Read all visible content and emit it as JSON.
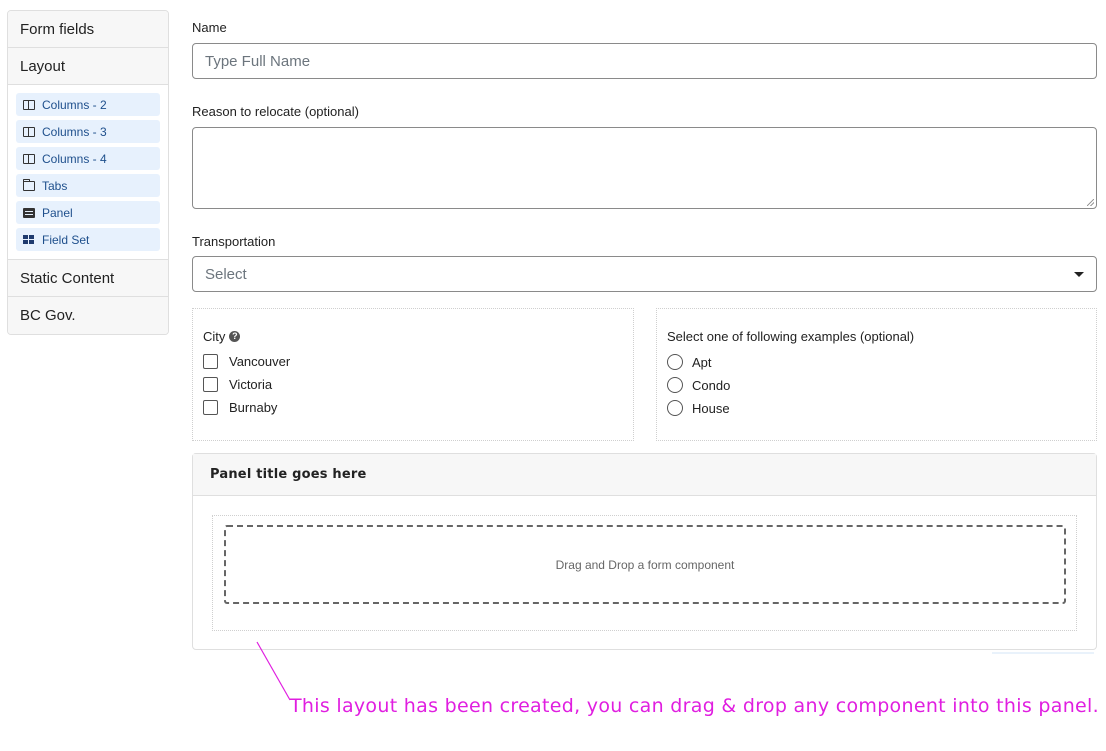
{
  "sidebar": {
    "sections": [
      {
        "label": "Form fields"
      },
      {
        "label": "Layout"
      }
    ],
    "layout_items": [
      {
        "label": "Columns - 2",
        "icon": "columns-icon"
      },
      {
        "label": "Columns - 3",
        "icon": "columns-icon"
      },
      {
        "label": "Columns - 4",
        "icon": "columns-icon"
      },
      {
        "label": "Tabs",
        "icon": "folder-icon"
      },
      {
        "label": "Panel",
        "icon": "list-alt-icon"
      },
      {
        "label": "Field Set",
        "icon": "th-large-icon"
      }
    ],
    "footer_sections": [
      {
        "label": "Static Content"
      },
      {
        "label": "BC Gov."
      }
    ]
  },
  "form": {
    "name": {
      "label": "Name",
      "placeholder": "Type Full Name"
    },
    "reason": {
      "label": "Reason to relocate (optional)",
      "value": ""
    },
    "transportation": {
      "label": "Transportation",
      "selected": "Select"
    },
    "city": {
      "label": "City",
      "options": [
        "Vancouver",
        "Victoria",
        "Burnaby"
      ]
    },
    "examples": {
      "label": "Select one of following examples (optional)",
      "options": [
        "Apt",
        "Condo",
        "House"
      ]
    },
    "panel": {
      "title": "Panel title goes here",
      "dropzone_text": "Drag and Drop a form component"
    }
  },
  "annotation": {
    "text": "This layout has been created, you can drag & drop any component into this panel.",
    "color": "#e01ee0"
  },
  "colors": {
    "component_bg": "#e7f1fd",
    "component_text": "#1e4f8c"
  }
}
